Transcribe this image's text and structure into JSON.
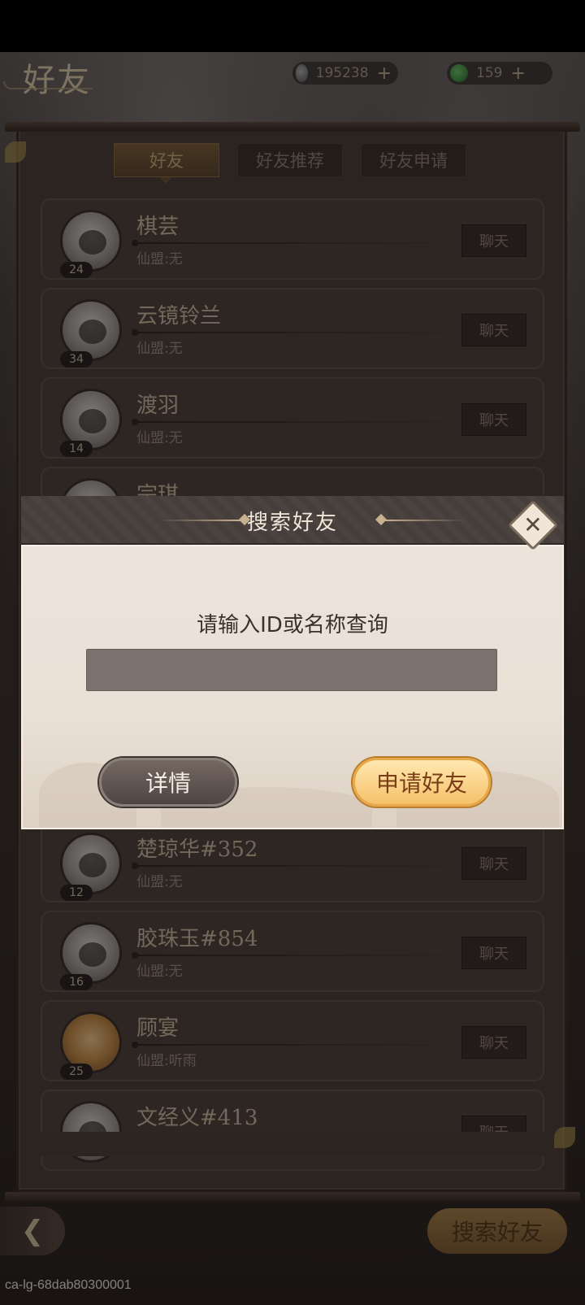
{
  "header": {
    "title": "好友",
    "currency1": {
      "value": "195238",
      "icon": "silver-coin-icon"
    },
    "currency2": {
      "value": "159",
      "icon": "jade-icon"
    },
    "plus_label": "+"
  },
  "tabs": [
    {
      "label": "好友",
      "active": true
    },
    {
      "label": "好友推荐",
      "active": false
    },
    {
      "label": "好友申请",
      "active": false
    }
  ],
  "friends": [
    {
      "name": "棋芸",
      "guild": "仙盟:无",
      "level": "24",
      "chat_label": "聊天"
    },
    {
      "name": "云镜铃兰",
      "guild": "仙盟:无",
      "level": "34",
      "chat_label": "聊天"
    },
    {
      "name": "渡羽",
      "guild": "仙盟:无",
      "level": "14",
      "chat_label": "聊天"
    },
    {
      "name": "宗琪",
      "guild": "",
      "level": "",
      "chat_label": ""
    },
    {
      "name": "楚琼华#352",
      "guild": "仙盟:无",
      "level": "12",
      "chat_label": "聊天"
    },
    {
      "name": "胶珠玉#854",
      "guild": "仙盟:无",
      "level": "16",
      "chat_label": "聊天"
    },
    {
      "name": "顾宴",
      "guild": "仙盟:听雨",
      "level": "25",
      "chat_label": "聊天"
    },
    {
      "name": "文经义#413",
      "guild": "",
      "level": "",
      "chat_label": "聊天"
    }
  ],
  "footer": {
    "back_icon": "back-arrow-icon",
    "search_button": "搜索好友",
    "watermark": "ca-lg-68dab80300001"
  },
  "dialog": {
    "title": "搜索好友",
    "close_icon": "close-icon",
    "prompt": "请输入ID或名称查询",
    "input_value": "",
    "details_button": "详情",
    "apply_button": "申请好友"
  }
}
